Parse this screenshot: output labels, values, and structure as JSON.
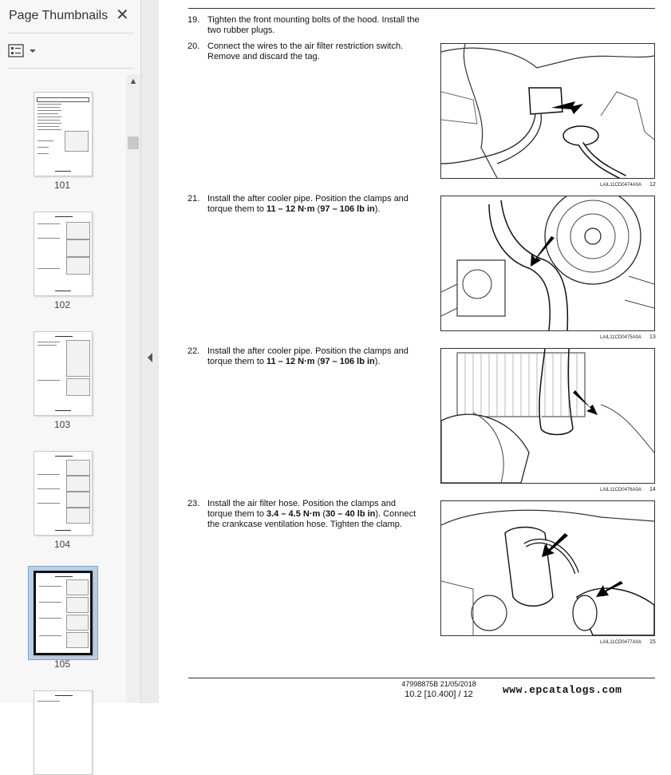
{
  "sidebar": {
    "title": "Page Thumbnails",
    "thumbnails": [
      {
        "label": "101"
      },
      {
        "label": "102"
      },
      {
        "label": "103"
      },
      {
        "label": "104"
      },
      {
        "label": "105",
        "selected": true
      }
    ]
  },
  "document": {
    "steps": [
      {
        "num": "19.",
        "text": "Tighten the front mounting bolts of the hood.  Install the two rubber plugs."
      },
      {
        "num": "20.",
        "text": "Connect the wires to the air filter restriction switch. Remove and discard the tag."
      },
      {
        "num": "21.",
        "text_pre": "Install the after cooler pipe.  Position the clamps and torque them to ",
        "bold1": "11 – 12 N·m",
        "mid": " (",
        "bold2": "97 – 106 lb in",
        "post": ")."
      },
      {
        "num": "22.",
        "text_pre": "Install the after cooler pipe.  Position the clamps and torque them to ",
        "bold1": "11 – 12 N·m",
        "mid": " (",
        "bold2": "97 – 106 lb in",
        "post": ")."
      },
      {
        "num": "23.",
        "text_pre": "Install the air filter hose.  Position the clamps and torque them to ",
        "bold1": "3.4 – 4.5 N·m",
        "mid": " (",
        "bold2": "30 – 40 lb in",
        "post": "). Connect the crankcase ventilation hose. Tighten the clamp."
      }
    ],
    "figures": [
      {
        "caption": "LAIL11CD0474A0A",
        "number": "12"
      },
      {
        "caption": "LAIL11CD0475A0A",
        "number": "13"
      },
      {
        "caption": "LAIL11CD0476A0A",
        "number": "14"
      },
      {
        "caption": "LAIL11CD0477A0A",
        "number": "15"
      }
    ],
    "footer": {
      "doc_id": "47998875B 21/05/2018",
      "page_ref": "10.2 [10.400] / 12"
    },
    "watermark": "www.epcatalogs.com"
  },
  "colors": {
    "sidebar_bg": "#f7f7f7",
    "selection": "#b9cfe6"
  },
  "icons": [
    "close-icon",
    "thumbnail-options-icon",
    "chevron-down-icon",
    "scroll-up-icon",
    "collapse-left-icon"
  ]
}
